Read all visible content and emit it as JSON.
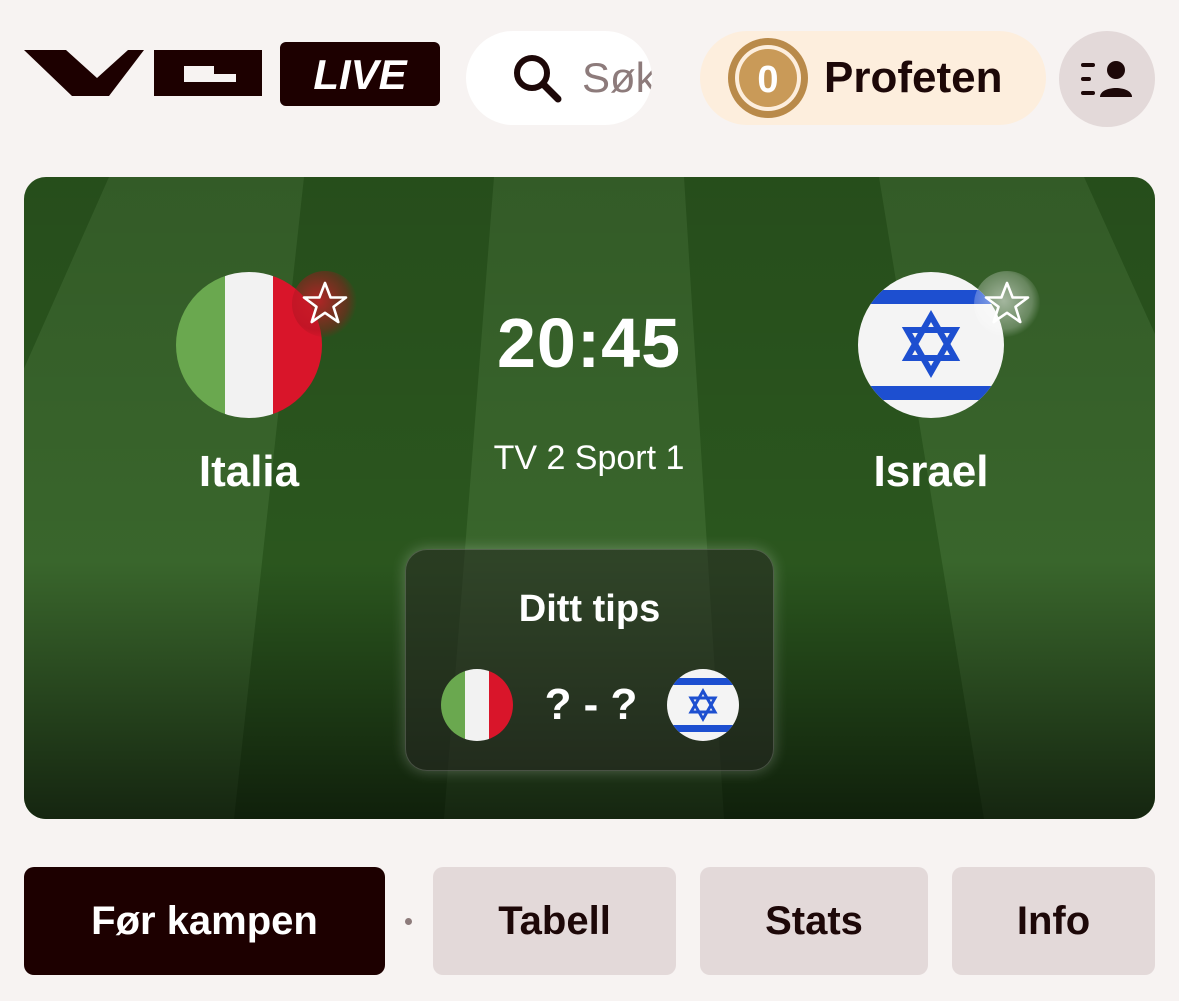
{
  "header": {
    "logo_alt": "VG LIVE",
    "search": {
      "placeholder": "Søk"
    },
    "profeten": {
      "coins": "0",
      "label": "Profeten"
    },
    "profile_icon": "profile-list-icon"
  },
  "match": {
    "home": {
      "name": "Italia",
      "flag": "italy-flag-icon"
    },
    "away": {
      "name": "Israel",
      "flag": "israel-flag-icon"
    },
    "kickoff": "20:45",
    "channel": "TV 2 Sport 1",
    "tips": {
      "title": "Ditt tips",
      "score": "? - ?"
    }
  },
  "tabs": [
    {
      "label": "Før kampen",
      "active": true
    },
    {
      "label": "Tabell",
      "active": false
    },
    {
      "label": "Stats",
      "active": false
    },
    {
      "label": "Info",
      "active": false
    }
  ],
  "colors": {
    "background": "#f7f3f2",
    "brand_dark": "#1d0000",
    "pill_profeten": "#fdeedd",
    "tab_inactive": "#e3d9d9",
    "pitch_green": "#2f5c22"
  }
}
